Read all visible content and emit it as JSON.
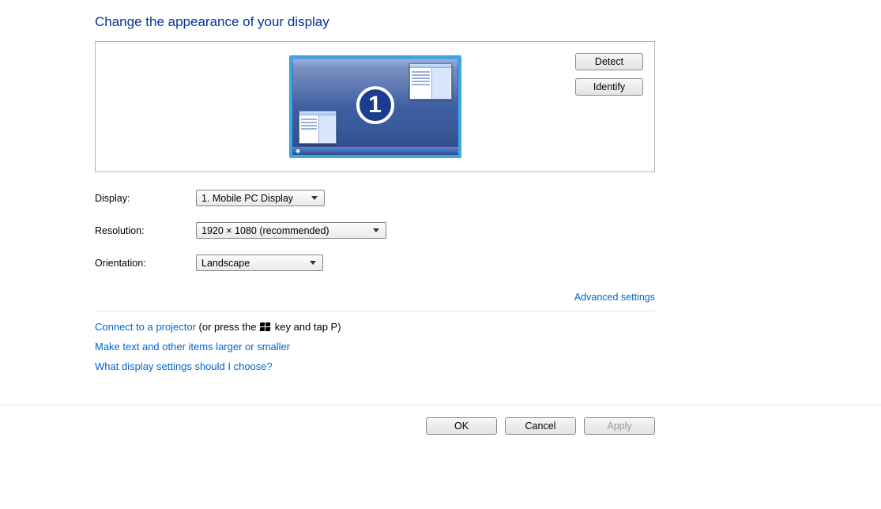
{
  "title": "Change the appearance of your display",
  "buttons": {
    "detect": "Detect",
    "identify": "Identify",
    "ok": "OK",
    "cancel": "Cancel",
    "apply": "Apply"
  },
  "monitor": {
    "number": "1"
  },
  "form": {
    "display_label": "Display:",
    "display_value": "1. Mobile PC Display",
    "resolution_label": "Resolution:",
    "resolution_value": "1920 × 1080 (recommended)",
    "orientation_label": "Orientation:",
    "orientation_value": "Landscape"
  },
  "links": {
    "advanced": "Advanced settings",
    "projector_link": "Connect to a projector",
    "projector_suffix_a": " (or press the ",
    "projector_suffix_b": " key and tap P)",
    "text_size": "Make text and other items larger or smaller",
    "help": "What display settings should I choose?"
  }
}
